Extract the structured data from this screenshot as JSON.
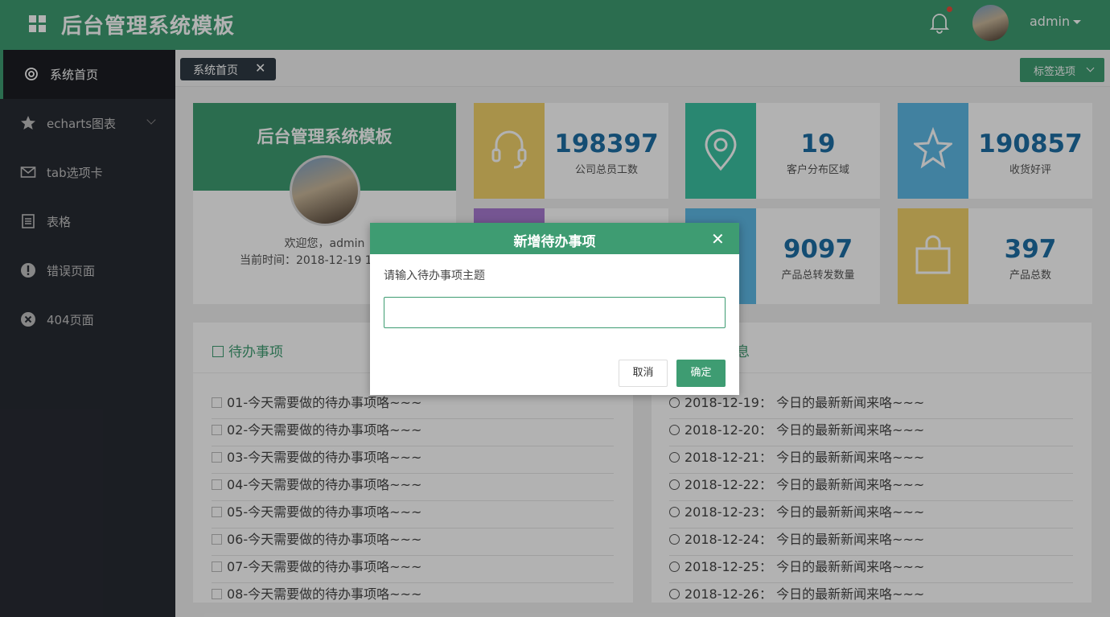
{
  "header": {
    "title": "后台管理系统模板",
    "user": "admin",
    "brand_color": "#3e9c72",
    "icons": [
      "grid-icon",
      "bell-icon",
      "avatar",
      "caret-down-icon"
    ]
  },
  "sidebar": {
    "items": [
      {
        "label": "系统首页",
        "icon": "dashboard-icon",
        "active": true
      },
      {
        "label": "echarts图表",
        "icon": "star-icon",
        "has_submenu": true
      },
      {
        "label": "tab选项卡",
        "icon": "mail-icon"
      },
      {
        "label": "表格",
        "icon": "table-icon"
      },
      {
        "label": "错误页面",
        "icon": "exclamation-icon"
      },
      {
        "label": "404页面",
        "icon": "x-circle-icon"
      }
    ]
  },
  "tabs": {
    "active": "系统首页",
    "close_glyph": "✕",
    "options_label": "标签选项"
  },
  "profile": {
    "title": "后台管理系统模板",
    "welcome": "欢迎您，admin",
    "time": "当前时间：2018-12-19 1"
  },
  "stats": [
    {
      "value": "198397",
      "caption": "公司总员工数",
      "color": "#f1d26a",
      "icon": "headset-icon"
    },
    {
      "value": "19",
      "caption": "客户分布区域",
      "color": "#3cc2a3",
      "icon": "location-pin-icon"
    },
    {
      "value": "190857",
      "caption": "收货好评",
      "color": "#5eb9e6",
      "icon": "star-icon"
    },
    {
      "value": "9097",
      "caption": "产品总转发数量",
      "color": "#5eb9e6",
      "icon": "share-icon"
    },
    {
      "value": "397",
      "caption": "产品总数",
      "color": "#f1d26a",
      "icon": "shopping-bag-icon"
    }
  ],
  "todo": {
    "title": "待办事项",
    "items": [
      "01-今天需要做的待办事项咯~~~",
      "02-今天需要做的待办事项咯~~~",
      "03-今天需要做的待办事项咯~~~",
      "04-今天需要做的待办事项咯~~~",
      "05-今天需要做的待办事项咯~~~",
      "06-今天需要做的待办事项咯~~~",
      "07-今天需要做的待办事项咯~~~",
      "08-今天需要做的待办事项咯~~~"
    ]
  },
  "news": {
    "title_visible_fragment": "息",
    "items": [
      "2018-12-19： 今日的最新新闻来咯~~~",
      "2018-12-20： 今日的最新新闻来咯~~~",
      "2018-12-21： 今日的最新新闻来咯~~~",
      "2018-12-22： 今日的最新新闻来咯~~~",
      "2018-12-23： 今日的最新新闻来咯~~~",
      "2018-12-24： 今日的最新新闻来咯~~~",
      "2018-12-25： 今日的最新新闻来咯~~~",
      "2018-12-26： 今日的最新新闻来咯~~~"
    ]
  },
  "dialog": {
    "title": "新增待办事项",
    "close_glyph": "✕",
    "prompt": "请输入待办事项主题",
    "input_value": "",
    "cancel_label": "取消",
    "ok_label": "确定"
  }
}
